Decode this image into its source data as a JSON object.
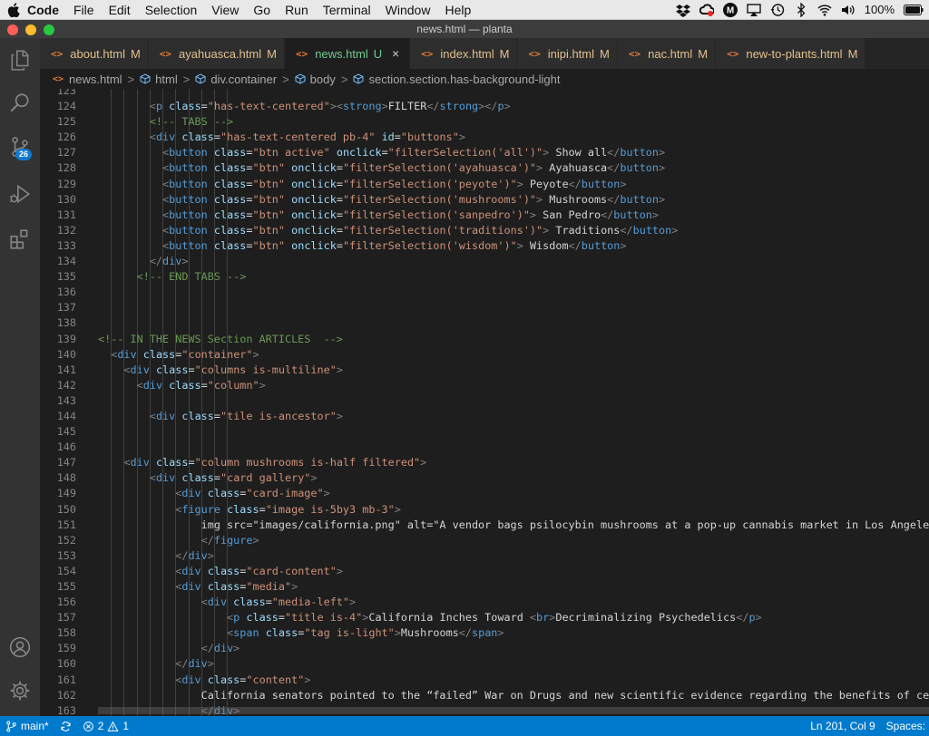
{
  "menubar": {
    "app": "Code",
    "items": [
      "File",
      "Edit",
      "Selection",
      "View",
      "Go",
      "Run",
      "Terminal",
      "Window",
      "Help"
    ],
    "battery": "100%",
    "tray_icons": [
      "dropbox-icon",
      "creative-cloud-icon",
      "m-app-icon",
      "airplay-icon",
      "time-machine-icon",
      "bluetooth-icon",
      "wifi-icon",
      "volume-icon",
      "battery-icon"
    ]
  },
  "window": {
    "title": "news.html — planta"
  },
  "activity": {
    "source_control_badge": "26"
  },
  "tabs": [
    {
      "name": "about.html",
      "status": "M",
      "active": false
    },
    {
      "name": "ayahuasca.html",
      "status": "M",
      "active": false
    },
    {
      "name": "news.html",
      "status": "U",
      "active": true
    },
    {
      "name": "index.html",
      "status": "M",
      "active": false
    },
    {
      "name": "inipi.html",
      "status": "M",
      "active": false
    },
    {
      "name": "nac.html",
      "status": "M",
      "active": false
    },
    {
      "name": "new-to-plants.html",
      "status": "M",
      "active": false
    }
  ],
  "tab_icon_glyph": "<>",
  "tab_close_glyph": "×",
  "breadcrumb": {
    "file": "news.html",
    "items": [
      "html",
      "div.container",
      "body",
      "section.section.has-background-light"
    ],
    "separator": ">"
  },
  "editor": {
    "lines": [
      {
        "n": "123",
        "t": ""
      },
      {
        "n": "124",
        "t": "        <p class=\"has-text-centered\"><strong>FILTER</strong></p>"
      },
      {
        "n": "125",
        "t": "        <!-- TABS -->"
      },
      {
        "n": "126",
        "t": "        <div class=\"has-text-centered pb-4\" id=\"buttons\">"
      },
      {
        "n": "127",
        "t": "          <button class=\"btn active\" onclick=\"filterSelection('all')\"> Show all</button>"
      },
      {
        "n": "128",
        "t": "          <button class=\"btn\" onclick=\"filterSelection('ayahuasca')\"> Ayahuasca</button>"
      },
      {
        "n": "129",
        "t": "          <button class=\"btn\" onclick=\"filterSelection('peyote')\"> Peyote</button>"
      },
      {
        "n": "130",
        "t": "          <button class=\"btn\" onclick=\"filterSelection('mushrooms')\"> Mushrooms</button>"
      },
      {
        "n": "131",
        "t": "          <button class=\"btn\" onclick=\"filterSelection('sanpedro')\"> San Pedro</button>"
      },
      {
        "n": "132",
        "t": "          <button class=\"btn\" onclick=\"filterSelection('traditions')\"> Traditions</button>"
      },
      {
        "n": "133",
        "t": "          <button class=\"btn\" onclick=\"filterSelection('wisdom')\"> Wisdom</button>"
      },
      {
        "n": "134",
        "t": "        </div>"
      },
      {
        "n": "135",
        "t": "      <!-- END TABS -->"
      },
      {
        "n": "136",
        "t": ""
      },
      {
        "n": "137",
        "t": ""
      },
      {
        "n": "138",
        "t": ""
      },
      {
        "n": "139",
        "t": "<!-- IN THE NEWS Section ARTICLES  -->"
      },
      {
        "n": "140",
        "t": "  <div class=\"container\">"
      },
      {
        "n": "141",
        "t": "    <div class=\"columns is-multiline\">"
      },
      {
        "n": "142",
        "t": "      <div class=\"column\">"
      },
      {
        "n": "143",
        "t": ""
      },
      {
        "n": "144",
        "t": "        <div class=\"tile is-ancestor\">"
      },
      {
        "n": "145",
        "t": ""
      },
      {
        "n": "146",
        "t": ""
      },
      {
        "n": "147",
        "t": "    <div class=\"column mushrooms is-half filtered\">"
      },
      {
        "n": "148",
        "t": "        <div class=\"card gallery\">"
      },
      {
        "n": "149",
        "t": "            <div class=\"card-image\">"
      },
      {
        "n": "150",
        "t": "            <figure class=\"image is-5by3 mb-3\">"
      },
      {
        "n": "151",
        "t": "                <img src=\"images/california.png\" alt=\"A vendor bags psilocybin mushrooms at a pop-up cannabis market in Los Angeles, M"
      },
      {
        "n": "152",
        "t": "                </figure>"
      },
      {
        "n": "153",
        "t": "            </div>"
      },
      {
        "n": "154",
        "t": "            <div class=\"card-content\">"
      },
      {
        "n": "155",
        "t": "            <div class=\"media\">"
      },
      {
        "n": "156",
        "t": "                <div class=\"media-left\">"
      },
      {
        "n": "157",
        "t": "                    <p class=\"title is-4\">California Inches Toward <br>Decriminalizing Psychedelics</p>"
      },
      {
        "n": "158",
        "t": "                    <span class=\"tag is-light\">Mushrooms</span>"
      },
      {
        "n": "159",
        "t": "                </div>"
      },
      {
        "n": "160",
        "t": "            </div>"
      },
      {
        "n": "161",
        "t": "            <div class=\"content\">"
      },
      {
        "n": "162",
        "t": "                California senators pointed to the “failed” War on Drugs and new scientific evidence regarding the benefits of certain"
      },
      {
        "n": "163",
        "t": "                </div>"
      }
    ],
    "link_values": [
      "images/california.png"
    ]
  },
  "statusbar": {
    "branch": "main*",
    "errors": "2",
    "warnings": "1",
    "cursor": "Ln 201, Col 9",
    "indent": "Spaces:"
  },
  "colors": {
    "tag": "#569cd6",
    "punct": "#808080",
    "attr": "#9cdcfe",
    "value": "#ce9178",
    "comment": "#6a9955",
    "text": "#d4d4d4",
    "statusbar": "#007acc",
    "modified": "#e2c08d",
    "untracked": "#73c991"
  }
}
